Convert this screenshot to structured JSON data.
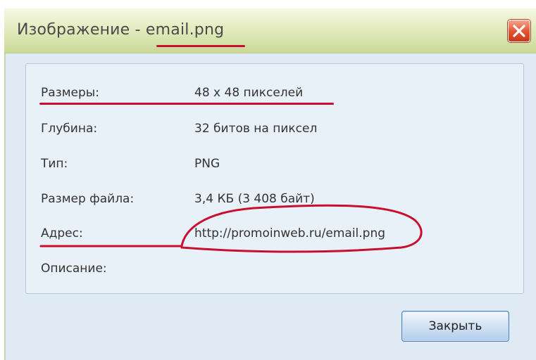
{
  "dialog": {
    "title": "Изображение - email.png",
    "close_label": "Закрыть"
  },
  "properties": [
    {
      "label": "Размеры:",
      "value": "48 x 48 пикселей"
    },
    {
      "label": "Глубина:",
      "value": "32 битов на пиксел"
    },
    {
      "label": "Тип:",
      "value": "PNG"
    },
    {
      "label": "Размер файла:",
      "value": "3,4 КБ (3 408 байт)"
    },
    {
      "label": "Адрес:",
      "value": "http://promoinweb.ru/email.png"
    },
    {
      "label": "Описание:",
      "value": ""
    }
  ],
  "colors": {
    "annotation": "#c8102e",
    "titlebar": "#e5ecc0",
    "close_button": "#e0512f",
    "panel": "#e8f0f8"
  },
  "icons": {
    "close": "close-icon"
  }
}
